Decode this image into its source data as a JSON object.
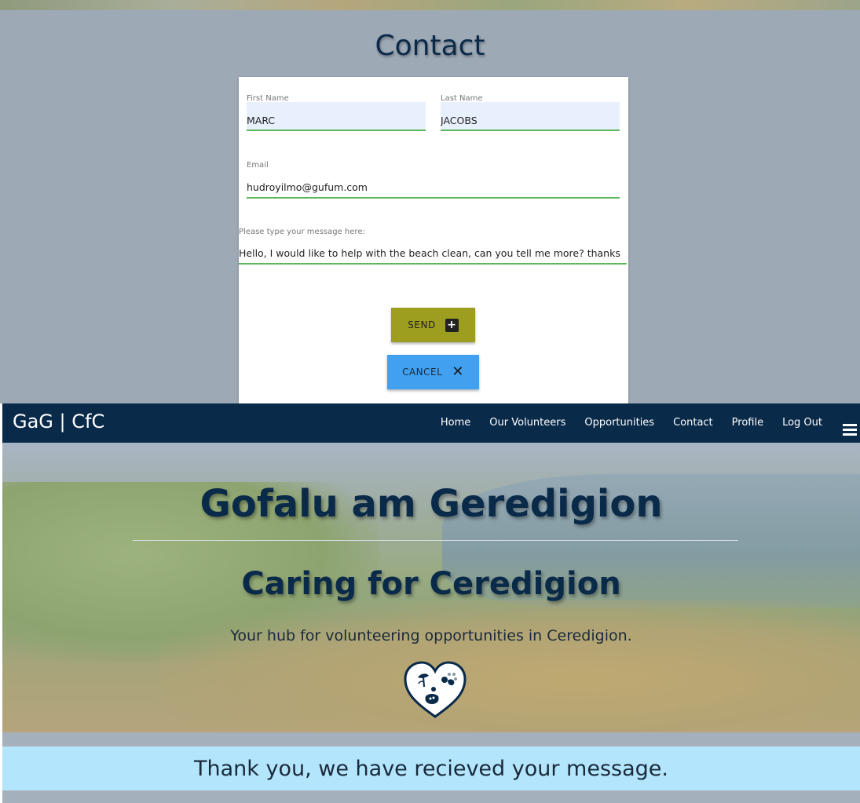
{
  "contact_page": {
    "title": "Contact",
    "form": {
      "first_name": {
        "label": "First Name",
        "value": "MARC"
      },
      "last_name": {
        "label": "Last Name",
        "value": "JACOBS"
      },
      "email": {
        "label": "Email",
        "value": "hudroyilmo@gufum.com"
      },
      "message": {
        "label": "Please type your message here:",
        "value": "Hello, I would like to help with the beach clean, can you tell me more? thanks"
      }
    },
    "send_button": {
      "label": "SEND",
      "icon": "plus-box-icon"
    },
    "cancel_button": {
      "label": "CANCEL",
      "icon": "close-icon"
    }
  },
  "navbar": {
    "brand": "GaG | CfC",
    "links": [
      "Home",
      "Our Volunteers",
      "Opportunities",
      "Contact",
      "Profile",
      "Log Out"
    ],
    "menu_icon": "hamburger-icon"
  },
  "hero": {
    "title": "Gofalu am Geredigion",
    "subtitle": "Caring for Ceredigion",
    "tagline": "Your hub for volunteering opportunities in Ceredigion.",
    "logo_icon": "heart-logo-icon"
  },
  "alert": {
    "message": "Thank you, we have recieved your message."
  },
  "colors": {
    "navy": "#0a2a4a",
    "send": "#9d9d1f",
    "cancel": "#41a0f0",
    "alert_bg": "#b3e5fc",
    "input_underline": "#5cb85c"
  }
}
